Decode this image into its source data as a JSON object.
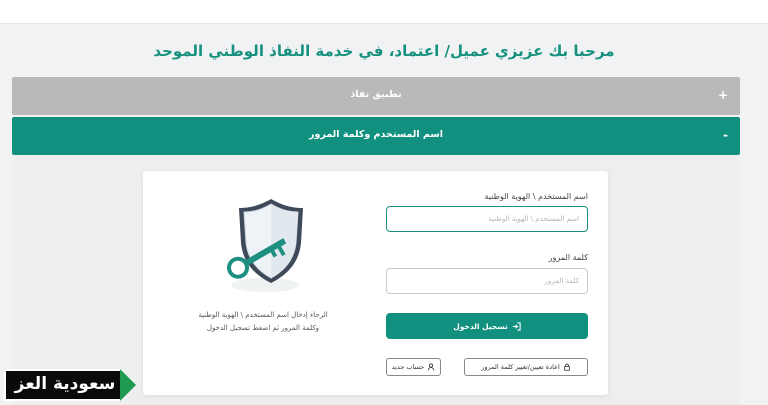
{
  "welcome_title": "مرحبا بك عزيزي عميل/ اعتماد، في خدمة النفاذ الوطني الموحد",
  "accordion": {
    "nafath": {
      "label": "تطبيق نفاذ",
      "toggle": "+"
    },
    "username_password": {
      "label": "اسم المستخدم وكلمة المرور",
      "toggle": "-"
    }
  },
  "form": {
    "username_label": "اسم المستخدم \\ الهوية الوطنية",
    "username_placeholder": "اسم المستخدم \\ الهوية الوطنية",
    "password_label": "كلمة المرور",
    "password_placeholder": "كلمة المرور",
    "login_button": "تسجيل الدخول",
    "reset_password_button": "اعادة تعيين/تغيير كلمة المرور",
    "new_account_button": "حساب جديد"
  },
  "help_text_line1": "الرجاء إدخال اسم المستخدم \\ الهوية الوطنية",
  "help_text_line2": "وكلمة المرور ثم اضغط تسجيل الدخول",
  "logo_text": "سعودية العز",
  "colors": {
    "primary": "#12907f",
    "collapsed_header": "#b9b9b9",
    "logo_accent": "#1e9a52"
  },
  "icons": {
    "login": "login-arrow-icon",
    "reset": "lock-icon",
    "new_account": "user-icon",
    "illustration": "shield-key-icon"
  }
}
